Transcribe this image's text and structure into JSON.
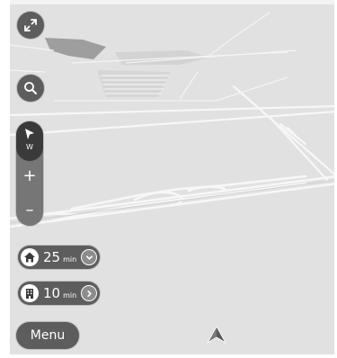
{
  "controls": {
    "fullscreen_icon": "expand-arrows-icon",
    "search_icon": "magnifier-icon"
  },
  "compass": {
    "heading_letter": "W"
  },
  "zoom": {
    "plus_label": "+",
    "minus_label": "–"
  },
  "eta": [
    {
      "icon": "home-icon",
      "value": "25",
      "unit": "min"
    },
    {
      "icon": "office-building-icon",
      "value": "10",
      "unit": "min"
    }
  ],
  "menu": {
    "label": "Menu"
  },
  "current_position": {
    "icon": "navigation-arrow-icon"
  },
  "colors": {
    "map_background": "#e2e2e2",
    "road": "#f7f7f7",
    "button": "#5d5d5d",
    "compass": "#3a3a3a"
  }
}
